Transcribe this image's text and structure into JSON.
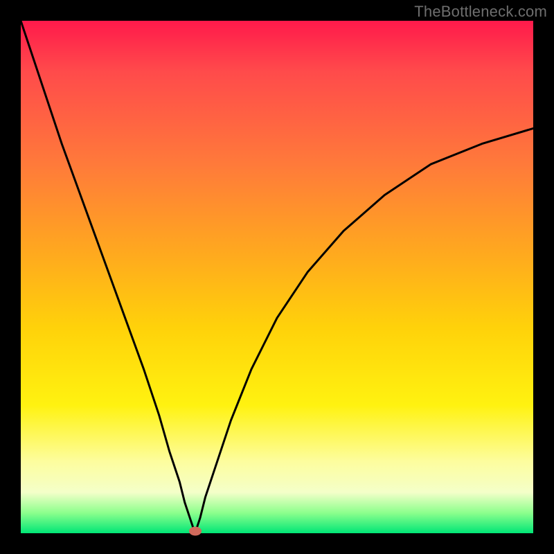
{
  "watermark": "TheBottleneck.com",
  "colors": {
    "background_frame": "#000000",
    "gradient_top": "#ff1a4b",
    "gradient_mid1": "#ff7a3a",
    "gradient_mid2": "#ffd20a",
    "gradient_mid3": "#fdfd9e",
    "gradient_bottom": "#00e676",
    "curve": "#000000",
    "marker": "#d06a5c"
  },
  "chart_data": {
    "type": "line",
    "title": "",
    "xlabel": "",
    "ylabel": "",
    "xlim": [
      0,
      100
    ],
    "ylim": [
      0,
      100
    ],
    "annotations": [],
    "marker": {
      "x": 34,
      "y": 0
    },
    "series": [
      {
        "name": "bottleneck-curve",
        "x": [
          0,
          2,
          5,
          8,
          12,
          16,
          20,
          24,
          27,
          29,
          31,
          32,
          33,
          34,
          35,
          36,
          38,
          41,
          45,
          50,
          56,
          63,
          71,
          80,
          90,
          100
        ],
        "values": [
          100,
          94,
          85,
          76,
          65,
          54,
          43,
          32,
          23,
          16,
          10,
          6,
          3,
          0,
          3,
          7,
          13,
          22,
          32,
          42,
          51,
          59,
          66,
          72,
          76,
          79
        ]
      }
    ]
  }
}
